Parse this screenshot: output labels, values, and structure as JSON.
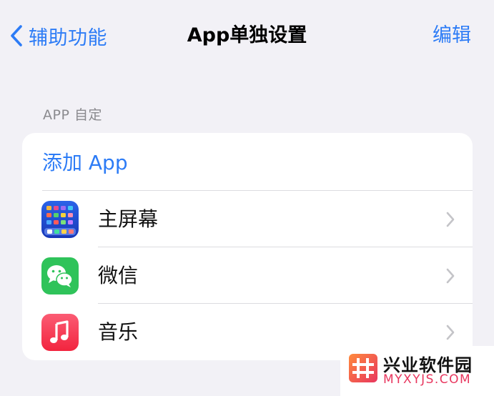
{
  "nav": {
    "back_label": "辅助功能",
    "title": "App单独设置",
    "edit_label": "编辑"
  },
  "section": {
    "header": "APP 自定"
  },
  "list": {
    "add_label": "添加 App",
    "items": [
      {
        "label": "主屏幕",
        "icon": "home-screen-icon"
      },
      {
        "label": "微信",
        "icon": "wechat-icon"
      },
      {
        "label": "音乐",
        "icon": "music-icon"
      }
    ]
  },
  "watermark": {
    "title": "兴业软件园",
    "subtitle": "MYXYJS.COM"
  },
  "colors": {
    "accent": "#2d7cf6",
    "background": "#f2f1f6",
    "wechat": "#2fc35a",
    "music": "#f43b50",
    "home_screen": "#1f4fd8"
  }
}
